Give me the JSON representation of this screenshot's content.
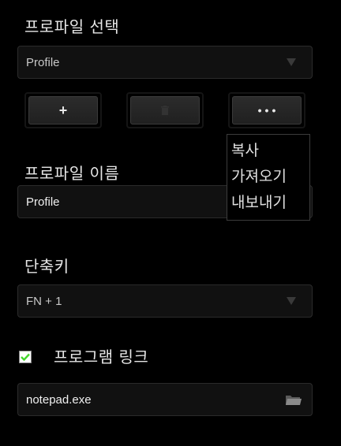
{
  "profile_select": {
    "title": "프로파일 선택",
    "value": "Profile"
  },
  "actions": {
    "add_label": "+",
    "more_label": "•••"
  },
  "more_menu": {
    "items": [
      "복사",
      "가져오기",
      "내보내기"
    ]
  },
  "profile_name": {
    "title": "프로파일 이름",
    "value": "Profile"
  },
  "shortcut": {
    "title": "단축키",
    "value": "FN + 1"
  },
  "program_link": {
    "label": "프로그램 링크",
    "checked": true,
    "value": "notepad.exe"
  },
  "colors": {
    "accent": "#44d62c",
    "background": "#000000"
  }
}
